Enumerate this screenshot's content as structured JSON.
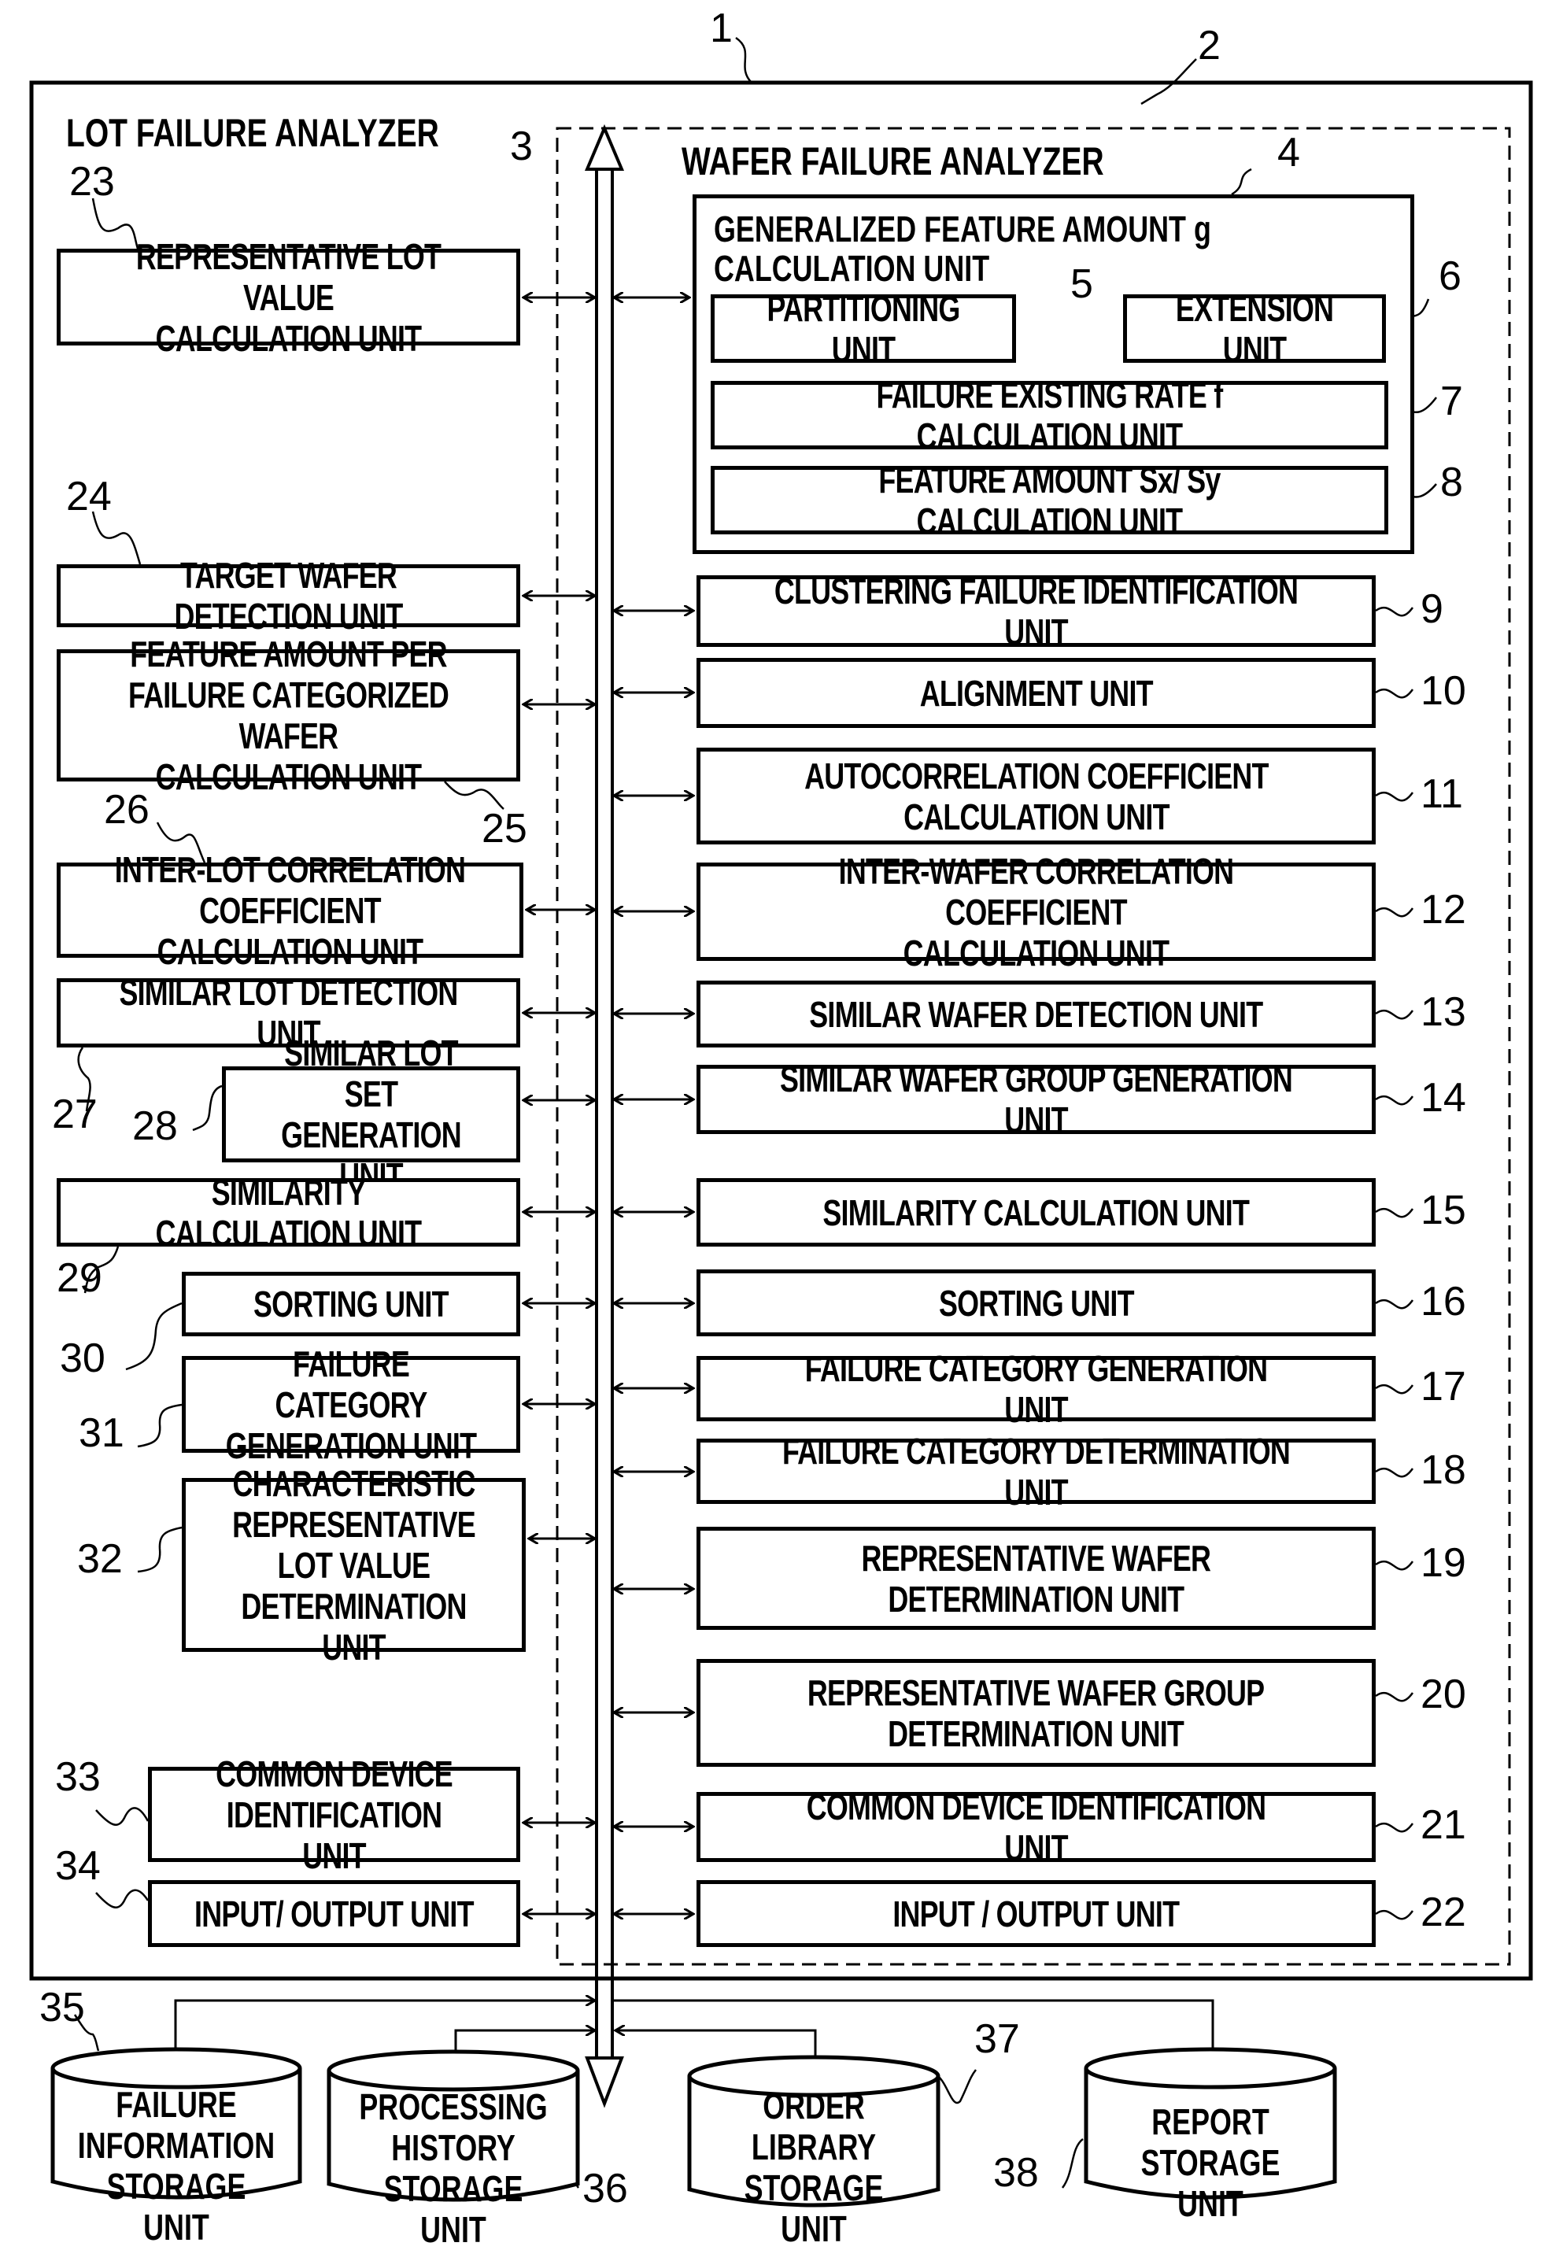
{
  "diagram": {
    "lot_analyzer": {
      "title": "LOT FAILURE ANALYZER",
      "ref": "1"
    },
    "wafer_analyzer": {
      "title": "WAFER FAILURE ANALYZER",
      "ref": "2"
    },
    "bus_ref": "3",
    "generalized_unit": {
      "label": "GENERALIZED FEATURE AMOUNT g\nCALCULATION UNIT",
      "ref": "4"
    },
    "wafer_units": [
      {
        "ref": "5",
        "label": "PARTITIONING UNIT"
      },
      {
        "ref": "6",
        "label": "EXTENSION UNIT"
      },
      {
        "ref": "7",
        "label": "FAILURE EXISTING RATE f CALCULATION UNIT"
      },
      {
        "ref": "8",
        "label": "FEATURE AMOUNT Sx/ Sy CALCULATION UNIT"
      },
      {
        "ref": "9",
        "label": "CLUSTERING FAILURE IDENTIFICATION UNIT"
      },
      {
        "ref": "10",
        "label": "ALIGNMENT UNIT"
      },
      {
        "ref": "11",
        "label": "AUTOCORRELATION COEFFICIENT\nCALCULATION UNIT"
      },
      {
        "ref": "12",
        "label": "INTER-WAFER CORRELATION COEFFICIENT\nCALCULATION UNIT"
      },
      {
        "ref": "13",
        "label": "SIMILAR WAFER DETECTION UNIT"
      },
      {
        "ref": "14",
        "label": "SIMILAR WAFER GROUP GENERATION UNIT"
      },
      {
        "ref": "15",
        "label": "SIMILARITY CALCULATION UNIT"
      },
      {
        "ref": "16",
        "label": "SORTING UNIT"
      },
      {
        "ref": "17",
        "label": "FAILURE CATEGORY GENERATION UNIT"
      },
      {
        "ref": "18",
        "label": "FAILURE CATEGORY DETERMINATION UNIT"
      },
      {
        "ref": "19",
        "label": "REPRESENTATIVE WAFER\nDETERMINATION UNIT"
      },
      {
        "ref": "20",
        "label": "REPRESENTATIVE WAFER GROUP\nDETERMINATION UNIT"
      },
      {
        "ref": "21",
        "label": "COMMON DEVICE IDENTIFICATION UNIT"
      },
      {
        "ref": "22",
        "label": "INPUT / OUTPUT UNIT"
      }
    ],
    "lot_units": [
      {
        "ref": "23",
        "label": "REPRESENTATIVE LOT VALUE\nCALCULATION UNIT"
      },
      {
        "ref": "24",
        "label": "TARGET WAFER DETECTION UNIT"
      },
      {
        "ref": "25",
        "label": "FEATURE AMOUNT PER\nFAILURE CATEGORIZED WAFER\nCALCULATION UNIT"
      },
      {
        "ref": "26",
        "label": "INTER-LOT CORRELATION\nCOEFFICIENT CALCULATION UNIT"
      },
      {
        "ref": "27",
        "label": "SIMILAR LOT DETECTION UNIT"
      },
      {
        "ref": "28",
        "label": "SIMILAR LOT SET\nGENERATION UNIT"
      },
      {
        "ref": "29",
        "label": "SIMILARITY CALCULATION UNIT"
      },
      {
        "ref": "30",
        "label": "SORTING UNIT"
      },
      {
        "ref": "31",
        "label": "FAILURE CATEGORY\nGENERATION UNIT"
      },
      {
        "ref": "32",
        "label": "CHARACTERISTIC\nREPRESENTATIVE\nLOT VALUE\nDETERMINATION UNIT"
      },
      {
        "ref": "33",
        "label": "COMMON DEVICE\nIDENTIFICATION UNIT"
      },
      {
        "ref": "34",
        "label": "INPUT/ OUTPUT UNIT"
      }
    ],
    "storage_units": [
      {
        "ref": "35",
        "label": "FAILURE\nINFORMATION\nSTORAGE UNIT"
      },
      {
        "ref": "36",
        "label": "PROCESSING\nHISTORY\nSTORAGE UNIT"
      },
      {
        "ref": "37",
        "label": "ORDER LIBRARY\nSTORAGE\nUNIT"
      },
      {
        "ref": "38",
        "label": "REPORT\nSTORAGE UNIT"
      }
    ]
  }
}
